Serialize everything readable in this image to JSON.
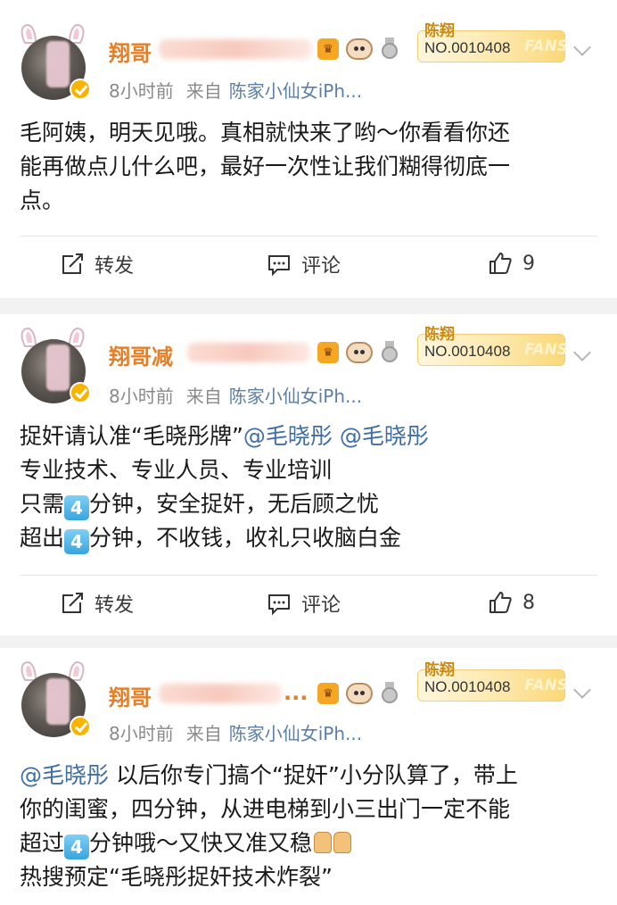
{
  "posts": [
    {
      "name": "翔哥",
      "time": "8小时前",
      "from_label": "来自",
      "source": "陈家小仙女iPh...",
      "fans_owner": "陈翔",
      "fans_no": "NO.0010408",
      "fans_watermark": "FANS",
      "content": [
        [
          {
            "t": "text",
            "v": "毛阿姨，明天见哦。真相就快来了哟～你看看你还"
          }
        ],
        [
          {
            "t": "text",
            "v": "能再做点儿什么吧，最好一次性让我们糊得彻底一"
          }
        ],
        [
          {
            "t": "text",
            "v": "点。"
          }
        ]
      ],
      "actions": {
        "share": "转发",
        "comment": "评论",
        "like": "9"
      }
    },
    {
      "name": "翔哥减",
      "time": "8小时前",
      "from_label": "来自",
      "source": "陈家小仙女iPh...",
      "fans_owner": "陈翔",
      "fans_no": "NO.0010408",
      "fans_watermark": "FANS",
      "content": [
        [
          {
            "t": "text",
            "v": "捉奸请认准“毛晓彤牌”"
          },
          {
            "t": "mention",
            "v": "@毛晓彤"
          },
          {
            "t": "text",
            "v": " "
          },
          {
            "t": "mention",
            "v": "@毛晓彤"
          }
        ],
        [
          {
            "t": "text",
            "v": "专业技术、专业人员、专业培训"
          }
        ],
        [
          {
            "t": "text",
            "v": "只需"
          },
          {
            "t": "num",
            "v": "4"
          },
          {
            "t": "text",
            "v": "分钟，安全捉奸，无后顾之忧"
          }
        ],
        [
          {
            "t": "text",
            "v": "超出"
          },
          {
            "t": "num",
            "v": "4"
          },
          {
            "t": "text",
            "v": "分钟，不收钱，收礼只收脑白金"
          }
        ]
      ],
      "actions": {
        "share": "转发",
        "comment": "评论",
        "like": "8"
      }
    },
    {
      "name": "翔哥",
      "name_tail": "...",
      "time": "8小时前",
      "from_label": "来自",
      "source": "陈家小仙女iPh...",
      "fans_owner": "陈翔",
      "fans_no": "NO.0010408",
      "fans_watermark": "FANS",
      "content": [
        [
          {
            "t": "mention",
            "v": "@毛晓彤"
          },
          {
            "t": "text",
            "v": " 以后你专门搞个“捉奸”小分队算了，带上"
          }
        ],
        [
          {
            "t": "text",
            "v": "你的闺蜜，四分钟，从进电梯到小三出门一定不能"
          }
        ],
        [
          {
            "t": "text",
            "v": "超过"
          },
          {
            "t": "num",
            "v": "4"
          },
          {
            "t": "text",
            "v": "分钟哦～又快又准又稳"
          },
          {
            "t": "thumb"
          },
          {
            "t": "thumb"
          }
        ],
        [
          {
            "t": "text",
            "v": "热搜预定“毛晓彤捉奸技术炸裂”"
          }
        ]
      ]
    }
  ],
  "badge_crown": "♛"
}
